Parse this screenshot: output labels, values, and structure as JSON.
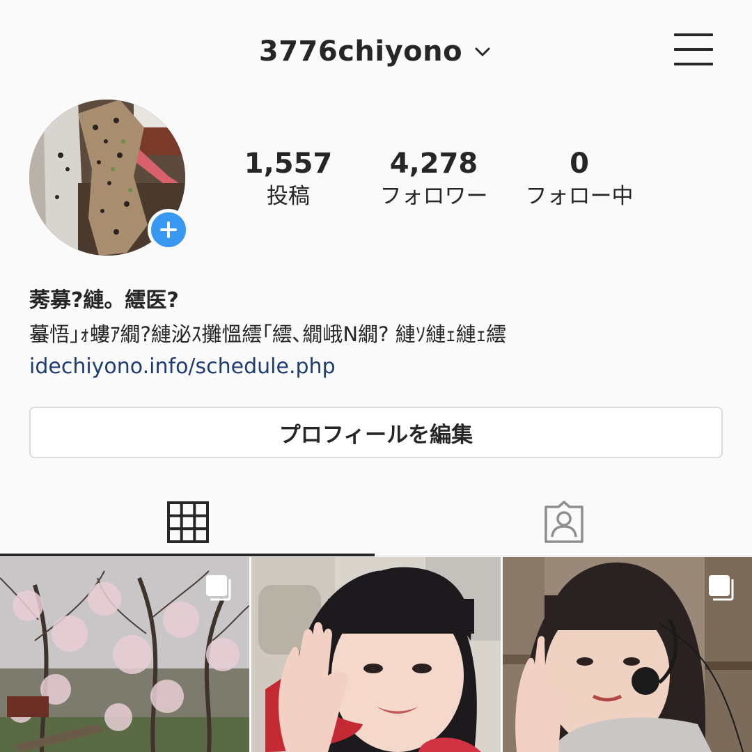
{
  "header": {
    "username": "3776chiyono",
    "dropdown_icon": "chevron-down-icon",
    "menu_icon": "hamburger-menu-icon"
  },
  "stats": [
    {
      "value": "1,557",
      "label": "投稿"
    },
    {
      "value": "4,278",
      "label": "フォロワー"
    },
    {
      "value": "0",
      "label": "フォロー中"
    }
  ],
  "bio": {
    "name": "莠募?縺。繧医?",
    "text": "蟇悟｣ｫ螻ｱ繝?縺泌ｽ攤慍繧｢繧､繝峨Ν繝? 縺ｿ縺ｪ縺ｪ繧",
    "link": "idechiyono.info/schedule.php"
  },
  "edit_profile_label": "プロフィールを編集",
  "tabs": [
    {
      "name": "grid",
      "icon": "grid-icon",
      "active": true
    },
    {
      "name": "tagged",
      "icon": "tagged-person-icon",
      "active": false
    }
  ],
  "posts": [
    {
      "subject": "cherry blossom trees",
      "multi": true
    },
    {
      "subject": "girl waving in car",
      "multi": false
    },
    {
      "subject": "girl with headset peace sign",
      "multi": true
    }
  ],
  "colors": {
    "background": "#fafafa",
    "text": "#262626",
    "link": "#1e3d73",
    "accent_blue": "#3897f0",
    "border": "#dbdbdb"
  }
}
